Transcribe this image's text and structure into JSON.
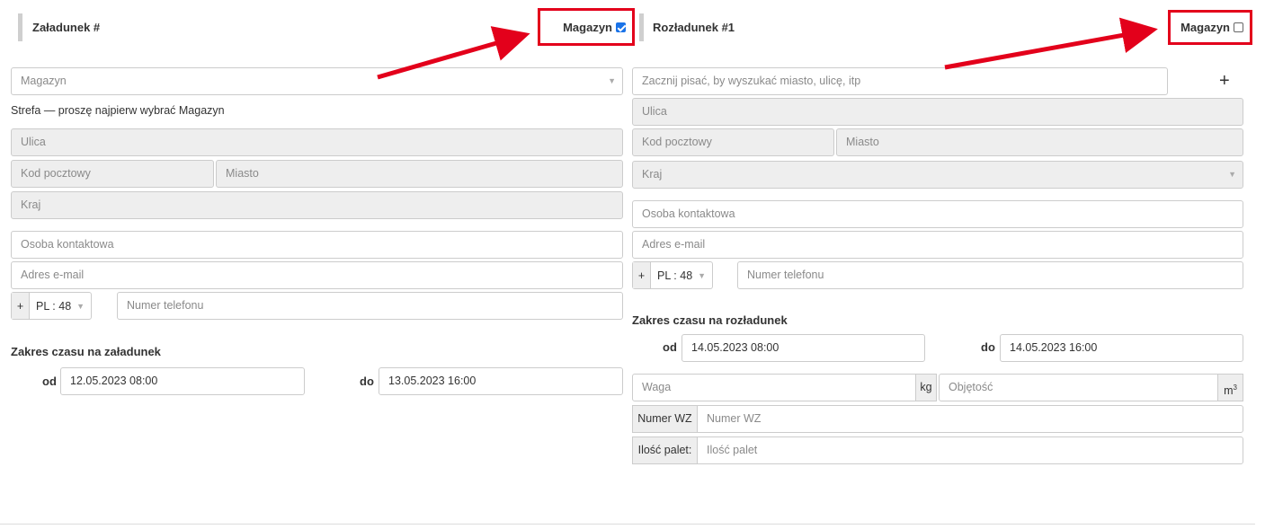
{
  "loading": {
    "title": "Załadunek #",
    "magazyn_label": "Magazyn",
    "magazyn_checked": true,
    "warehouse_select": "Magazyn",
    "zone_text": "Strefa — proszę najpierw wybrać Magazyn",
    "street": "Ulica",
    "postal": "Kod pocztowy",
    "city": "Miasto",
    "country": "Kraj",
    "contact": "Osoba kontaktowa",
    "email": "Adres e-mail",
    "phone_plus": "+",
    "phone_code": "PL : 48",
    "phone": "Numer telefonu",
    "time_title": "Zakres czasu na załadunek",
    "from_label": "od",
    "from_value": "12.05.2023 08:00",
    "to_label": "do",
    "to_value": "13.05.2023 16:00"
  },
  "unloading": {
    "title": "Rozładunek #1",
    "magazyn_label": "Magazyn",
    "magazyn_checked": false,
    "search_placeholder": "Zacznij pisać, by wyszukać miasto, ulicę, itp",
    "add_label": "+",
    "street": "Ulica",
    "postal": "Kod pocztowy",
    "city": "Miasto",
    "country": "Kraj",
    "contact": "Osoba kontaktowa",
    "email": "Adres e-mail",
    "phone_plus": "+",
    "phone_code": "PL : 48",
    "phone": "Numer telefonu",
    "time_title": "Zakres czasu na rozładunek",
    "from_label": "od",
    "from_value": "14.05.2023 08:00",
    "to_label": "do",
    "to_value": "14.05.2023 16:00",
    "weight_placeholder": "Waga",
    "weight_unit": "kg",
    "volume_placeholder": "Objętość",
    "volume_unit": "m",
    "volume_unit_sup": "3",
    "wz_label": "Numer WZ",
    "wz_placeholder": "Numer WZ",
    "pallets_label": "Ilość palet:",
    "pallets_placeholder": "Ilość palet"
  },
  "colors": {
    "annotation": "#e3001b",
    "checkbox_checked": "#1a73e8"
  }
}
